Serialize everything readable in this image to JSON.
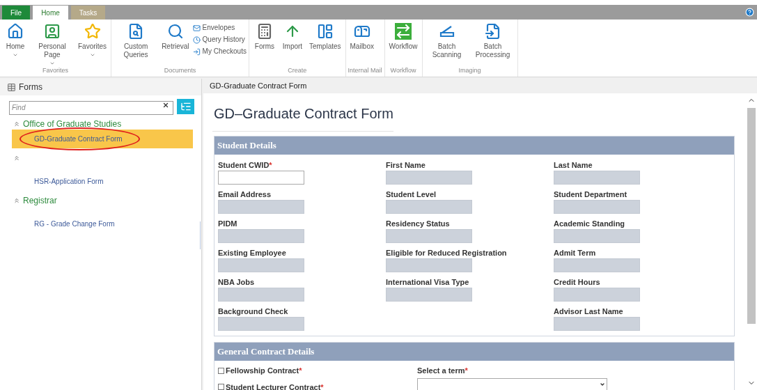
{
  "ribbon_tabs": [
    {
      "label": "File",
      "kind": "file",
      "selected": false
    },
    {
      "label": "Home",
      "kind": "tab",
      "selected": true
    },
    {
      "label": "Tasks",
      "kind": "context",
      "selected": false
    }
  ],
  "ribbon_groups": [
    {
      "label": "Favorites",
      "buttons": [
        {
          "label": "Home",
          "dropdown": true
        },
        {
          "label": "Personal Page",
          "dropdown": true
        },
        {
          "label": "Favorites",
          "dropdown": true
        }
      ]
    },
    {
      "label": "Documents",
      "buttons": [
        {
          "label": "Custom Queries",
          "dropdown": false
        },
        {
          "label": "Retrieval",
          "dropdown": false
        }
      ],
      "small_buttons": [
        "Envelopes",
        "Query History",
        "My Checkouts"
      ]
    },
    {
      "label": "Create",
      "buttons": [
        {
          "label": "Forms",
          "dropdown": false
        },
        {
          "label": "Import",
          "dropdown": false
        },
        {
          "label": "Templates",
          "dropdown": false
        }
      ]
    },
    {
      "label": "Internal Mail",
      "buttons": [
        {
          "label": "Mailbox",
          "dropdown": false
        }
      ]
    },
    {
      "label": "Workflow",
      "buttons": [
        {
          "label": "Workflow",
          "dropdown": false
        }
      ]
    },
    {
      "label": "Imaging",
      "buttons": [
        {
          "label": "Batch Scanning",
          "dropdown": false
        },
        {
          "label": "Batch Processing",
          "dropdown": false
        }
      ]
    }
  ],
  "sidebar": {
    "title": "Forms",
    "search": {
      "placeholder": "Find"
    },
    "groups": [
      {
        "label": "Office of Graduate Studies",
        "expanded": true,
        "children": [
          {
            "label": "GD-Graduate Contract Form",
            "selected": true,
            "circled": true
          }
        ]
      },
      {
        "expanded": true,
        "children": [
          {
            "label": "HSR-Application Form",
            "selected": false,
            "circled": false
          }
        ]
      },
      {
        "label": "Registrar",
        "expanded": true,
        "children": [
          {
            "label": "RG - Grade Change Form",
            "selected": false,
            "circled": false
          }
        ]
      }
    ]
  },
  "panel": {
    "title": "GD-Graduate Contract Form"
  },
  "form": {
    "title": "GD–Graduate Contract Form",
    "sections": [
      {
        "title": "Student Details",
        "kind": "grid",
        "rows": [
          [
            {
              "kind": "text",
              "label": "Student CWID",
              "required": true,
              "disabled": false
            },
            {
              "kind": "text",
              "label": "First Name",
              "required": false,
              "disabled": true
            },
            {
              "kind": "text",
              "label": "Last Name",
              "required": false,
              "disabled": true
            }
          ],
          [
            {
              "kind": "text",
              "label": "Email Address",
              "required": false,
              "disabled": true
            },
            {
              "kind": "text",
              "label": "Student Level",
              "required": false,
              "disabled": true
            },
            {
              "kind": "text",
              "label": "Student Department",
              "required": false,
              "disabled": true
            }
          ],
          [
            {
              "kind": "text",
              "label": "PIDM",
              "required": false,
              "disabled": true
            },
            {
              "kind": "text",
              "label": "Residency Status",
              "required": false,
              "disabled": true
            },
            {
              "kind": "text",
              "label": "Academic Standing",
              "required": false,
              "disabled": true
            }
          ],
          [
            {
              "kind": "text",
              "label": "Existing Employee",
              "required": false,
              "disabled": true
            },
            {
              "kind": "text",
              "label": "Eligible for Reduced Registration",
              "required": false,
              "disabled": true
            },
            {
              "kind": "text",
              "label": "Admit Term",
              "required": false,
              "disabled": true
            }
          ],
          [
            {
              "kind": "text",
              "label": "NBA Jobs",
              "required": false,
              "disabled": true
            },
            {
              "kind": "text",
              "label": "International Visa Type",
              "required": false,
              "disabled": true
            },
            {
              "kind": "text",
              "label": "Credit Hours",
              "required": false,
              "disabled": true
            }
          ],
          [
            {
              "kind": "text",
              "label": "Background Check",
              "required": false,
              "disabled": true
            },
            {
              "kind": "empty"
            },
            {
              "kind": "text",
              "label": "Advisor Last Name",
              "required": false,
              "disabled": true
            }
          ]
        ]
      },
      {
        "title": "General Contract Details",
        "kind": "contract",
        "checkboxes": [
          {
            "label": "Fellowship Contract",
            "required": true,
            "checked": false
          },
          {
            "label": "Student Lecturer Contract",
            "required": true,
            "checked": false
          }
        ],
        "select": {
          "label": "Select a term",
          "required": true
        }
      }
    ],
    "required_mark": "*"
  }
}
